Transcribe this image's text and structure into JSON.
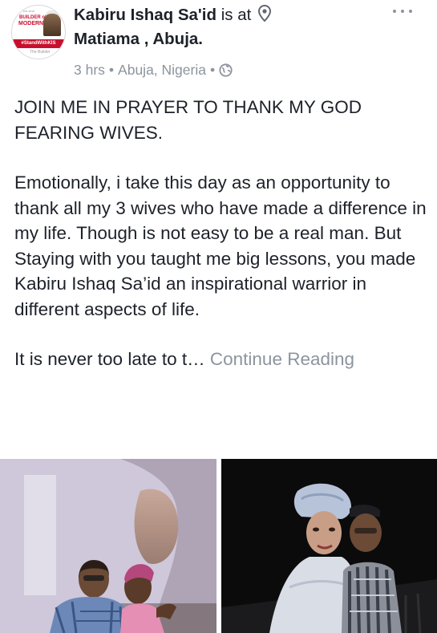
{
  "post": {
    "author": "Kabiru Ishaq Sa'id",
    "is_at": "is at",
    "location": "Matiama , Abuja.",
    "time": "3 hrs",
    "place": "Abuja, Nigeria",
    "separator": "•"
  },
  "avatar": {
    "line1": "BUILDER of",
    "line2": "MODERN",
    "band": "#StandWithKIS",
    "tail": "The Builder",
    "top_tag": "KIS 2019"
  },
  "body": {
    "heading": "JOIN ME IN PRAYER TO THANK MY GOD FEARING WIVES.",
    "paragraph": "Emotionally, i take this day as an opportunity to thank all my 3 wives who have made a difference in my life. Though is not easy to be a real man. But Staying with you taught me big lessons, you made Kabiru Ishaq Sa’id an inspirational warrior in different aspects of life.",
    "truncated": "It is never too late to t…",
    "continue": "Continue Reading"
  },
  "icons": {
    "pin": "location-pin-icon",
    "globe": "globe-icon",
    "more": "more-options-icon"
  },
  "colors": {
    "text": "#1d2129",
    "meta": "#8d949e",
    "brand_red": "#c8102e"
  }
}
